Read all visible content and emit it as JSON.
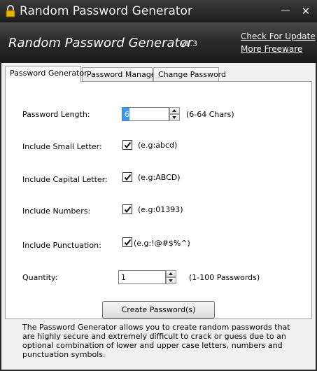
{
  "window": {
    "title": "Random Password Generator",
    "minimize_symbol": "—",
    "close_symbol": "✕"
  },
  "banner": {
    "app_title": "Random Password Generator",
    "version": "v1.3",
    "link_update": "Check For Update",
    "link_freeware": "More Freeware"
  },
  "tabs": [
    {
      "label": "Password Generator",
      "active": true
    },
    {
      "label": "Password Manager",
      "active": false
    },
    {
      "label": "Change Password",
      "active": false
    }
  ],
  "form": {
    "length": {
      "label": "Password Length:",
      "value": "6",
      "hint": "(6-64 Chars)"
    },
    "small": {
      "label": "Include Small Letter:",
      "checked": true,
      "hint": "(e.g:abcd)"
    },
    "capital": {
      "label": "Include Capital Letter:",
      "checked": true,
      "hint": "(e.g:ABCD)"
    },
    "numbers": {
      "label": "Include Numbers:",
      "checked": true,
      "hint": "(e.g:01393)"
    },
    "punctuation": {
      "label": "Include Punctuation:",
      "checked": true,
      "hint": "(e.g:!@#$%^)"
    },
    "quantity": {
      "label": "Quantity:",
      "value": "1",
      "hint": "(1-100 Passwords)"
    }
  },
  "create_button": "Create Password(s)",
  "description": "The Password Generator allows you to create random passwords that are highly secure and extremely difficult to crack or guess due to an optional combination of lower and upper case letters, numbers and punctuation symbols.",
  "colors": {
    "selection": "#3399ff",
    "titlebar": "#1c1c1c"
  }
}
